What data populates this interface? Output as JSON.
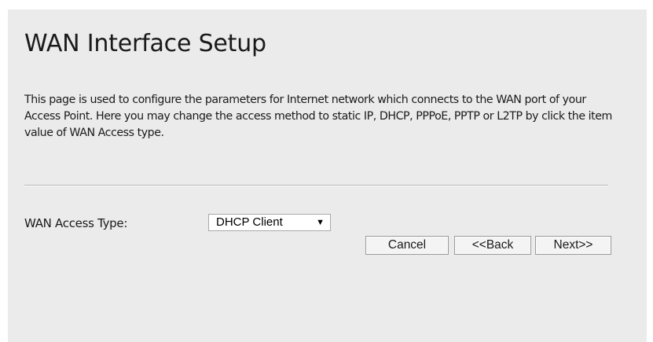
{
  "page": {
    "title": "WAN Interface Setup",
    "description": "This page is used to configure the parameters for Internet network which connects to the WAN port of your Access Point. Here you may change the access method to static IP, DHCP, PPPoE, PPTP or L2TP by click the item value of WAN Access type."
  },
  "form": {
    "access_type_label": "WAN Access Type:",
    "access_type_value": "DHCP Client",
    "dropdown_arrow": "▼"
  },
  "buttons": {
    "cancel": "Cancel",
    "back": "<<Back",
    "next": "Next>>"
  },
  "colors": {
    "panel_background": "#ebebeb",
    "text": "#1a1a1a",
    "button_background": "#f4f4f4",
    "button_border": "#9a9a9a"
  }
}
